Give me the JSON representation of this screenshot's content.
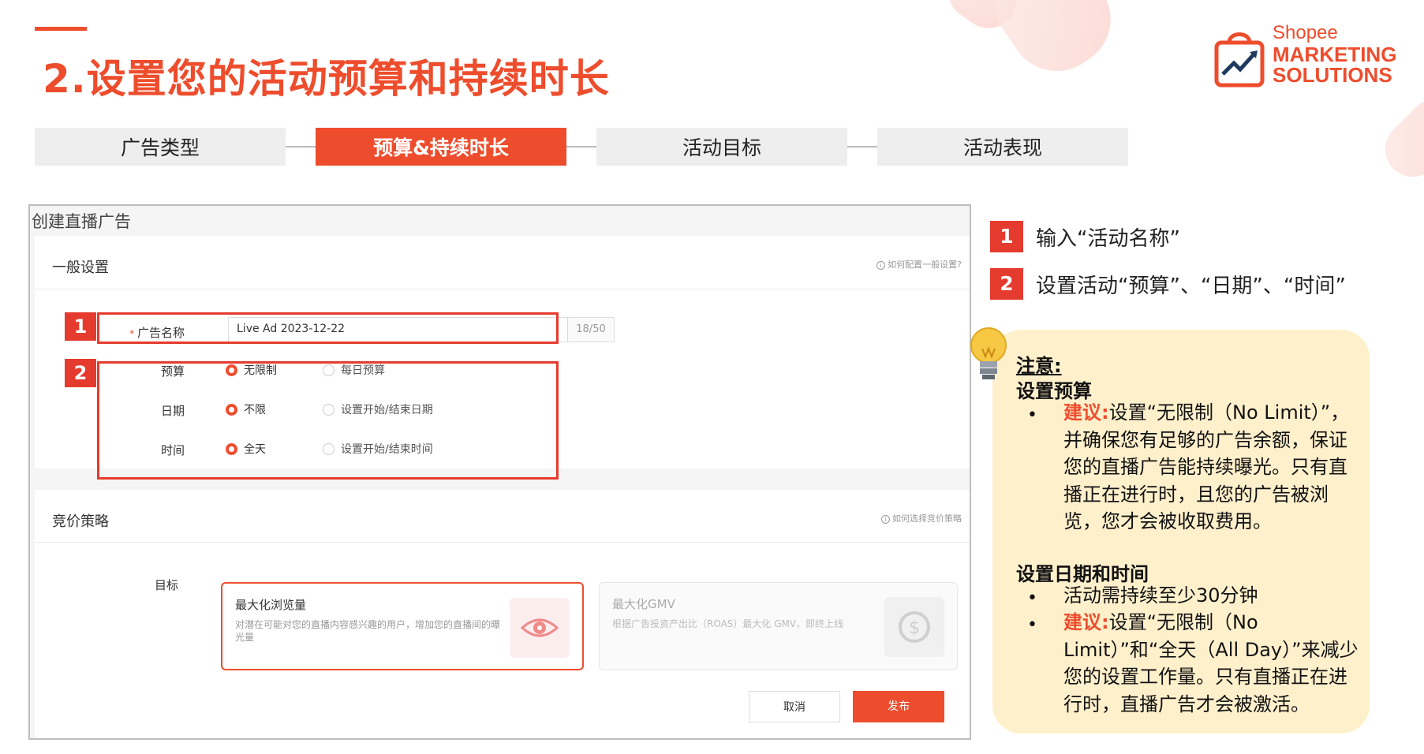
{
  "page_title": "2.设置您的活动预算和持续时长",
  "logo": {
    "line1": "Shopee",
    "line2": "MARKETING",
    "line3": "SOLUTIONS"
  },
  "steps": [
    "广告类型",
    "预算&持续时长",
    "活动目标",
    "活动表现"
  ],
  "panel": {
    "title": "创建直播广告",
    "general": {
      "heading": "一般设置",
      "help": "如何配置一般设置?",
      "ad_name_label": "广告名称",
      "ad_name_value": "Live Ad 2023-12-22",
      "counter": "18/50",
      "budget_label": "预算",
      "budget_opt1": "无限制",
      "budget_opt2": "每日预算",
      "date_label": "日期",
      "date_opt1": "不限",
      "date_opt2": "设置开始/结束日期",
      "time_label": "时间",
      "time_opt1": "全天",
      "time_opt2": "设置开始/结束时间"
    },
    "bidding": {
      "heading": "竞价策略",
      "help": "如何选择竞价策略",
      "goal_label": "目标",
      "goal1_title": "最大化浏览量",
      "goal1_desc": "对潜在可能对您的直播内容感兴趣的用户，增加您的直播间的曝光量",
      "goal2_title": "最大化GMV",
      "goal2_desc": "根据广告投资产出比（ROAS）最大化 GMV，即终上线"
    },
    "cancel": "取消",
    "publish": "发布"
  },
  "markers": [
    "1",
    "2"
  ],
  "right_steps": [
    {
      "num": "1",
      "text": "输入“活动名称”"
    },
    {
      "num": "2",
      "text": "设置活动“预算”、“日期”、“时间”"
    }
  ],
  "note": {
    "title": "注意:",
    "budget_heading": "设置预算",
    "advice_label": "建议:",
    "budget_text": "设置“无限制（No Limit）”，并确保您有足够的广告余额，保证您的直播广告能持续曝光。只有直播正在进行时，且您的广告被浏览，您才会被收取费用。",
    "time_heading": "设置日期和时间",
    "time_bullet1": "活动需持续至少30分钟",
    "time_bullet2": "设置“无限制（No Limit）”和“全天（All Day）”来减少您的设置工作量。只有直播正在进行时，直播广告才会被激活。",
    "bullet_char": "•"
  },
  "colors": {
    "brand": "#ee4d2d",
    "marker": "#e53b2e",
    "note_bg": "#fff0cc"
  }
}
